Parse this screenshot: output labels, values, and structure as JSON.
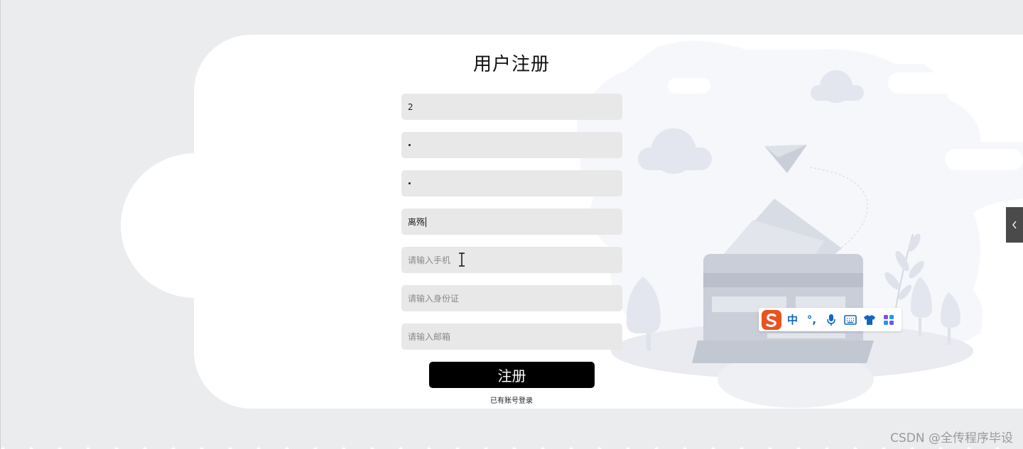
{
  "form": {
    "title": "用户注册",
    "fields": [
      {
        "value": "2",
        "placeholder": "",
        "masked": false
      },
      {
        "value": "",
        "placeholder": "",
        "masked": true
      },
      {
        "value": "",
        "placeholder": "",
        "masked": true
      },
      {
        "value": "离殇",
        "placeholder": "",
        "masked": false
      },
      {
        "value": "",
        "placeholder": "请输入手机",
        "masked": false
      },
      {
        "value": "",
        "placeholder": "请输入身份证",
        "masked": false
      },
      {
        "value": "",
        "placeholder": "请输入邮箱",
        "masked": false
      }
    ],
    "submit_label": "注册",
    "login_link": "已有账号登录"
  },
  "ime": {
    "items": [
      "中",
      "°,",
      "mic-icon",
      "keyboard-icon",
      "shirt-icon",
      "apps-icon"
    ],
    "lang_label": "中",
    "punct_label": "°,"
  },
  "watermark": "CSDN @全传程序毕设",
  "colors": {
    "page_bg": "#ebecee",
    "input_bg": "#e8e8e8",
    "button_bg": "#000000",
    "ime_logo": "#e8531f",
    "ime_icon": "#1565c0"
  }
}
